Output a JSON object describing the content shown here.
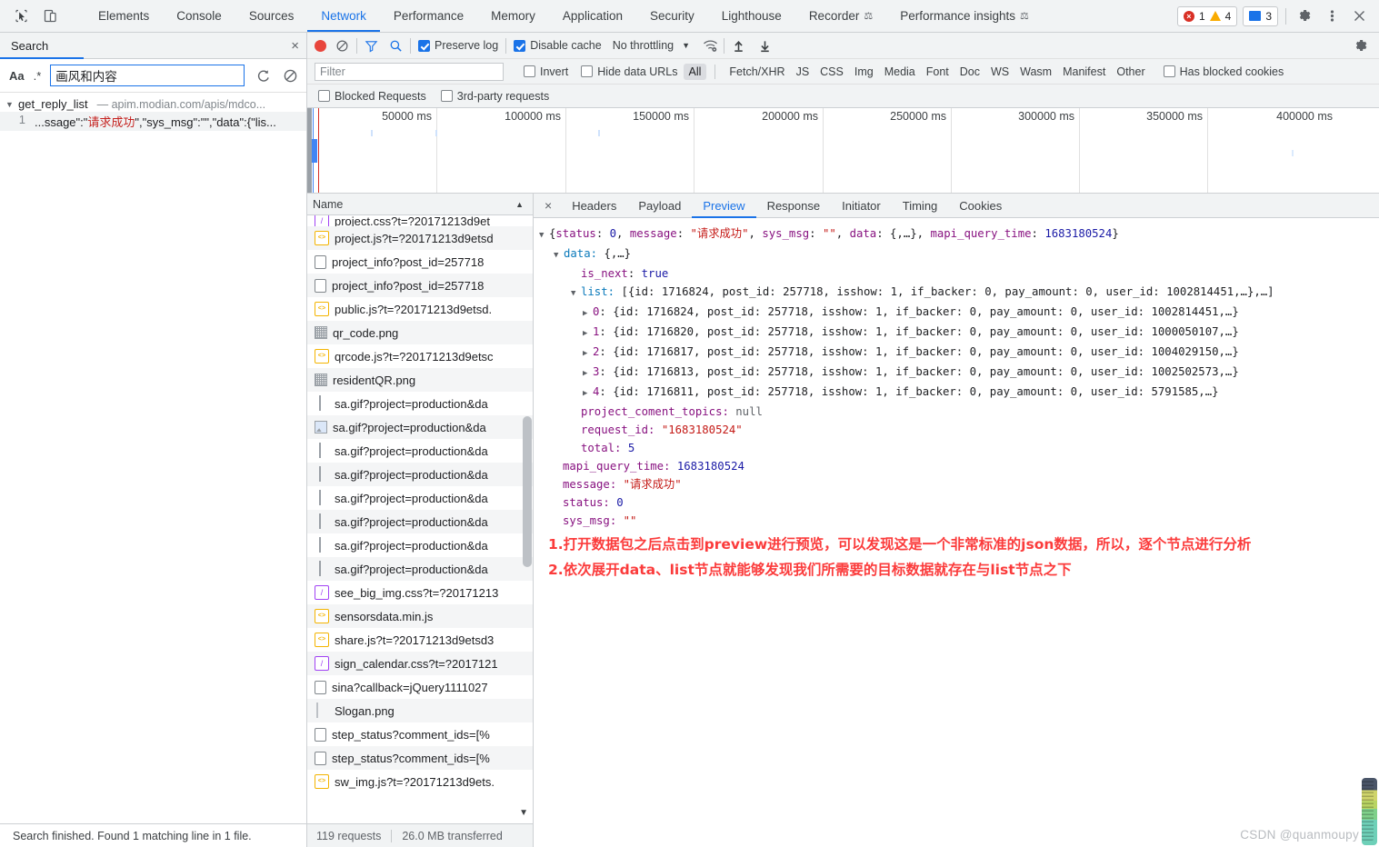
{
  "topbar": {
    "inspect_icon": "inspect-cursor-icon",
    "device_icon": "device-toolbar-icon",
    "tabs": [
      {
        "label": "Elements",
        "active": false,
        "flask": false
      },
      {
        "label": "Console",
        "active": false,
        "flask": false
      },
      {
        "label": "Sources",
        "active": false,
        "flask": false
      },
      {
        "label": "Network",
        "active": true,
        "flask": false
      },
      {
        "label": "Performance",
        "active": false,
        "flask": false
      },
      {
        "label": "Memory",
        "active": false,
        "flask": false
      },
      {
        "label": "Application",
        "active": false,
        "flask": false
      },
      {
        "label": "Security",
        "active": false,
        "flask": false
      },
      {
        "label": "Lighthouse",
        "active": false,
        "flask": false
      },
      {
        "label": "Recorder",
        "active": false,
        "flask": true
      },
      {
        "label": "Performance insights",
        "active": false,
        "flask": true
      }
    ],
    "error_count": "1",
    "warning_count": "4",
    "message_count": "3",
    "settings_icon": "gear-icon",
    "more_icon": "kebab-menu-icon",
    "close_icon": "close-icon"
  },
  "search_pane": {
    "title": "Search",
    "close_icon": "close-icon",
    "match_case_label": "Aa",
    "regex_label": ".*",
    "query_value": "画风和内容",
    "refresh_icon": "refresh-icon",
    "clear_icon": "clear-icon",
    "result_file": "get_reply_list",
    "result_dash": "—",
    "result_url": "apim.modian.com/apis/mdco...",
    "result_line_no": "1",
    "result_line_pre": "...ssage\":\"",
    "result_line_hl": "请求成功",
    "result_line_post": "\",\"sys_msg\":\"\",\"data\":{\"lis...",
    "status": "Search finished. Found 1 matching line in 1 file."
  },
  "network_toolbar": {
    "record_icon": "record-button",
    "clear_icon": "clear-icon",
    "filter_icon": "filter-funnel-icon",
    "search_icon": "search-icon",
    "preserve_log": "Preserve log",
    "preserve_log_checked": true,
    "disable_cache": "Disable cache",
    "disable_cache_checked": true,
    "throttling": "No throttling",
    "wifi_icon": "network-conditions-icon",
    "import_icon": "import-har-icon",
    "export_icon": "export-har-icon",
    "settings_icon": "network-settings-gear-icon"
  },
  "filter_row": {
    "placeholder": "Filter",
    "value": "",
    "invert": "Invert",
    "hide_data_urls": "Hide data URLs",
    "types": [
      "All",
      "Fetch/XHR",
      "JS",
      "CSS",
      "Img",
      "Media",
      "Font",
      "Doc",
      "WS",
      "Wasm",
      "Manifest",
      "Other"
    ],
    "active_type": "All",
    "has_blocked_cookies": "Has blocked cookies"
  },
  "blocked_row": {
    "blocked_requests": "Blocked Requests",
    "third_party": "3rd-party requests"
  },
  "overview": {
    "ticks": [
      "50000 ms",
      "100000 ms",
      "150000 ms",
      "200000 ms",
      "250000 ms",
      "300000 ms",
      "350000 ms",
      "400000 ms"
    ]
  },
  "request_list": {
    "column_header": "Name",
    "rows": [
      {
        "name": "project.css?t=?20171213d9et",
        "icon": "css-file-icon",
        "partial": true
      },
      {
        "name": "project.js?t=?20171213d9etsd",
        "icon": "js-file-icon"
      },
      {
        "name": "project_info?post_id=257718",
        "icon": "doc-file-icon"
      },
      {
        "name": "project_info?post_id=257718",
        "icon": "doc-file-icon"
      },
      {
        "name": "public.js?t=?20171213d9etsd.",
        "icon": "js-file-icon"
      },
      {
        "name": "qr_code.png",
        "icon": "image-file-icon"
      },
      {
        "name": "qrcode.js?t=?20171213d9etsc",
        "icon": "js-file-icon"
      },
      {
        "name": "residentQR.png",
        "icon": "image-file-icon"
      },
      {
        "name": "sa.gif?project=production&da",
        "icon": "generic-file-icon"
      },
      {
        "name": "sa.gif?project=production&da",
        "icon": "image-preview-icon"
      },
      {
        "name": "sa.gif?project=production&da",
        "icon": "generic-file-icon"
      },
      {
        "name": "sa.gif?project=production&da",
        "icon": "generic-file-icon"
      },
      {
        "name": "sa.gif?project=production&da",
        "icon": "generic-file-icon"
      },
      {
        "name": "sa.gif?project=production&da",
        "icon": "generic-file-icon"
      },
      {
        "name": "sa.gif?project=production&da",
        "icon": "generic-file-icon"
      },
      {
        "name": "sa.gif?project=production&da",
        "icon": "generic-file-icon"
      },
      {
        "name": "see_big_img.css?t=?20171213",
        "icon": "css-file-icon"
      },
      {
        "name": "sensorsdata.min.js",
        "icon": "js-file-icon"
      },
      {
        "name": "share.js?t=?20171213d9etsd3",
        "icon": "js-file-icon"
      },
      {
        "name": "sign_calendar.css?t=?2017121",
        "icon": "css-file-icon"
      },
      {
        "name": "sina?callback=jQuery1111027",
        "icon": "doc-file-icon"
      },
      {
        "name": "Slogan.png",
        "icon": "dash-file-icon"
      },
      {
        "name": "step_status?comment_ids=[%",
        "icon": "doc-file-icon"
      },
      {
        "name": "step_status?comment_ids=[%",
        "icon": "doc-file-icon"
      },
      {
        "name": "sw_img.js?t=?20171213d9ets.",
        "icon": "js-file-icon"
      }
    ],
    "status_requests": "119 requests",
    "status_transferred": "26.0 MB transferred"
  },
  "detail": {
    "close_icon": "close-icon",
    "tabs": [
      {
        "label": "Headers",
        "active": false
      },
      {
        "label": "Payload",
        "active": false
      },
      {
        "label": "Preview",
        "active": true
      },
      {
        "label": "Response",
        "active": false
      },
      {
        "label": "Initiator",
        "active": false
      },
      {
        "label": "Timing",
        "active": false
      },
      {
        "label": "Cookies",
        "active": false
      }
    ],
    "preview": {
      "root_open": "{status: 0, message: \"请求成功\", sys_msg: \"\", data: {,…}, mapi_query_time: 1683180524}",
      "root_parts": {
        "k_status": "status",
        "v_status": "0",
        "k_message": "message",
        "v_message": "\"请求成功\"",
        "k_sysmsg": "sys_msg",
        "v_sysmsg": "\"\"",
        "k_data": "data",
        "v_data": "{,…}",
        "k_mapi": "mapi_query_time",
        "v_mapi": "1683180524"
      },
      "data_label": "data:",
      "data_value": "{,…}",
      "is_next_key": "is_next",
      "is_next_val": "true",
      "list_key": "list:",
      "list_summary": "[{id: 1716824, post_id: 257718, isshow: 1, if_backer: 0, pay_amount: 0, user_id: 1002814451,…},…]",
      "items": [
        {
          "index": "0",
          "value": "{id: 1716824, post_id: 257718, isshow: 1, if_backer: 0, pay_amount: 0, user_id: 1002814451,…}"
        },
        {
          "index": "1",
          "value": "{id: 1716820, post_id: 257718, isshow: 1, if_backer: 0, pay_amount: 0, user_id: 1000050107,…}"
        },
        {
          "index": "2",
          "value": "{id: 1716817, post_id: 257718, isshow: 1, if_backer: 0, pay_amount: 0, user_id: 1004029150,…}"
        },
        {
          "index": "3",
          "value": "{id: 1716813, post_id: 257718, isshow: 1, if_backer: 0, pay_amount: 0, user_id: 1002502573,…}"
        },
        {
          "index": "4",
          "value": "{id: 1716811, post_id: 257718, isshow: 1, if_backer: 0, pay_amount: 0, user_id: 5791585,…}"
        }
      ],
      "topics_key": "project_coment_topics:",
      "topics_val": "null",
      "request_id_key": "request_id:",
      "request_id_val": "\"1683180524\"",
      "total_key": "total:",
      "total_val": "5",
      "mapi_key": "mapi_query_time:",
      "mapi_val": "1683180524",
      "message_key": "message:",
      "message_val": "\"请求成功\"",
      "status_key": "status:",
      "status_val": "0",
      "sysmsg_key": "sys_msg:",
      "sysmsg_val": "\"\""
    },
    "annotation_line1": "1.打开数据包之后点击到preview进行预览，可以发现这是一个非常标准的json数据，所以，逐个节点进行分析",
    "annotation_line2": "2.依次展开data、list节点就能够发现我们所需要的目标数据就存在与list节点之下"
  },
  "watermark": "CSDN @quanmoupy",
  "colors": {
    "accent": "#1a73e8",
    "error": "#d93025",
    "warning": "#f9ab00",
    "annotation": "#fb3b3b",
    "chrome_bg": "#f1f3f4"
  }
}
